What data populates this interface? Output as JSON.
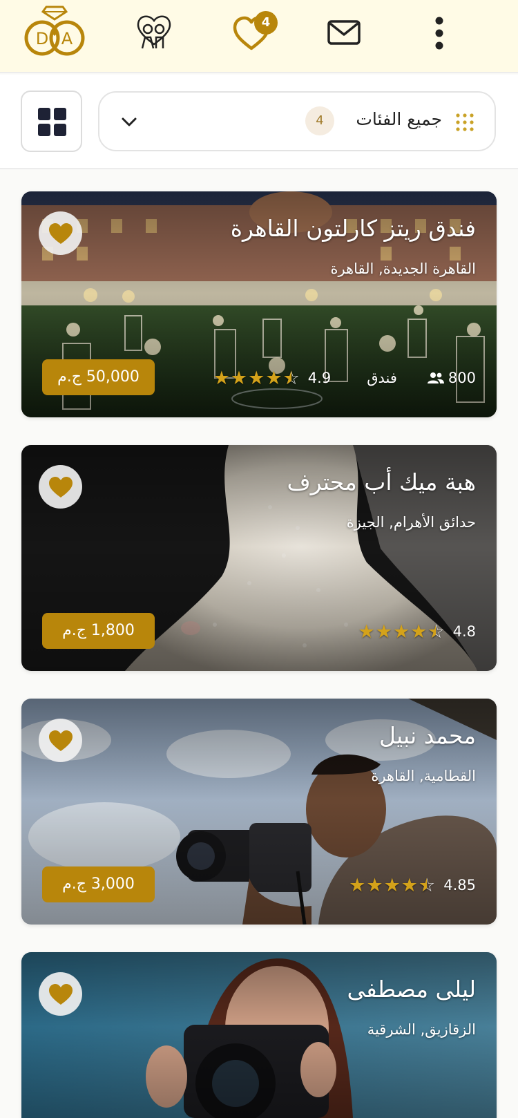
{
  "app": {
    "logo_letters": "D♥A",
    "favorites_count": "4"
  },
  "icons": {
    "logo": "ring-logo-icon",
    "couple": "couple-icon",
    "favorites": "heart-outline-icon",
    "messages": "mail-icon",
    "menu": "more-vertical-icon",
    "grid_view": "grid-view-icon",
    "category_dots": "dots-grid-icon",
    "dropdown": "chevron-down-icon",
    "card_favorite": "heart-filled-icon"
  },
  "filters": {
    "category_label": "جميع الفئات",
    "category_count": "4"
  },
  "colors": {
    "accent": "#b8860b",
    "topbar_bg": "#fffbe6",
    "star": "#d4a21a"
  },
  "listings": [
    {
      "title": "فندق ريتز كارلتون القاهرة",
      "location": "القاهرة الجديدة, القاهرة",
      "price": "50,000 ج.م",
      "rating": "4.9",
      "rating_value": 4.9,
      "type": "فندق",
      "capacity": "800"
    },
    {
      "title": "هبة ميك أب محترف",
      "location": "حدائق الأهرام, الجيزة",
      "price": "1,800 ج.م",
      "rating": "4.8",
      "rating_value": 4.8
    },
    {
      "title": "محمد نبيل",
      "location": "القطامية, القاهرة",
      "price": "3,000 ج.م",
      "rating": "4.85",
      "rating_value": 4.85
    },
    {
      "title": "ليلى مصطفى",
      "location": "الزقازيق, الشرقية"
    }
  ]
}
